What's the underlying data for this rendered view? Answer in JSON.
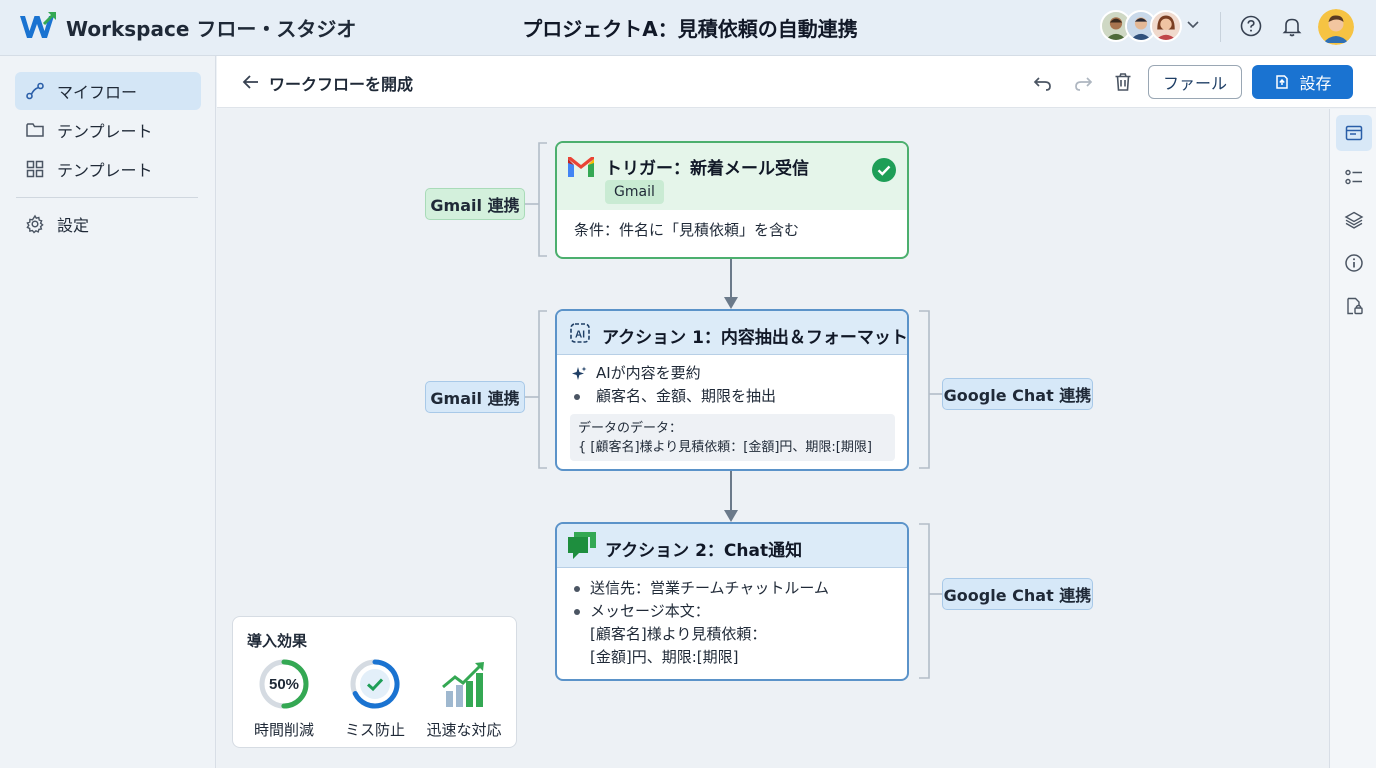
{
  "app": {
    "title": "Workspace フロー・スタジオ",
    "project_title": "プロジェクトA：見積依頼の自動連携"
  },
  "sidebar": {
    "items": [
      {
        "label": "マイフロー",
        "icon": "flow-icon",
        "active": true
      },
      {
        "label": "テンプレート",
        "icon": "folder-icon",
        "active": false
      },
      {
        "label": "テンプレート",
        "icon": "grid-icon",
        "active": false
      }
    ],
    "settings_label": "設定"
  },
  "header": {
    "title": "ワークフローを開成",
    "file_button": "ファール",
    "save_button": "設存"
  },
  "flow": {
    "trigger": {
      "title": "トリガー：新着メール受信",
      "chip": "Gmail",
      "condition": "条件：件名に「見積依頼」を含む",
      "status": "completed",
      "left_pill": "Gmail 連携"
    },
    "action1": {
      "title": "アクション 1：内容抽出＆フォーマット",
      "line1": "AIが内容を要約",
      "line2": "顧客名、金額、期限を抽出",
      "data_label": "データのデータ：",
      "data_value": "{ [顧客名]様より見積依頼：[金額]円、期限:[期限]",
      "left_pill": "Gmail 連携",
      "right_pill": "Google Chat 連携"
    },
    "action2": {
      "title": "アクション 2：Chat通知",
      "recipient": "送信先：営業チームチャットルーム",
      "message_label": "メッセージ本文：",
      "message_line1": "[顧客名]様より見積依頼：",
      "message_line2": "[金額]円、期限:[期限]",
      "right_pill": "Google Chat 連携"
    }
  },
  "impact": {
    "title": "導入効果",
    "metrics": [
      {
        "label": "時間削減",
        "value": "50%",
        "progress": 0.5
      },
      {
        "label": "ミス防止",
        "icon": "check-icon"
      },
      {
        "label": "迅速な対応",
        "icon": "growth-chart-icon"
      }
    ]
  },
  "colors": {
    "primary": "#1a73d1",
    "success": "#34a853",
    "trigger_border": "#4caf6e",
    "action_border": "#5b93c9"
  }
}
